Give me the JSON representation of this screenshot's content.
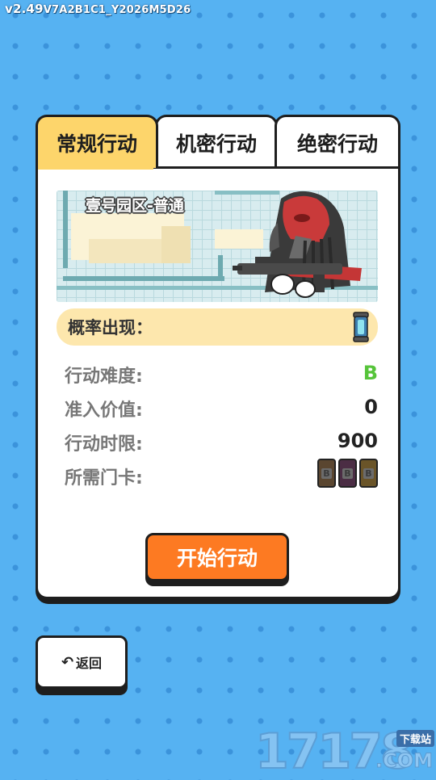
{
  "version": {
    "major": "v2.49",
    "build": "V7A2B1C1_Y2026M5D26"
  },
  "tabs": [
    {
      "label": "常规行动",
      "active": true
    },
    {
      "label": "机密行动",
      "active": false
    },
    {
      "label": "绝密行动",
      "active": false
    }
  ],
  "map": {
    "title": "壹号园区-普通"
  },
  "probability": {
    "label": "概率出现：",
    "item_icon": "capsule-item-icon"
  },
  "stats": [
    {
      "label": "行动难度:",
      "value": "B"
    },
    {
      "label": "准入价值:",
      "value": "0"
    },
    {
      "label": "行动时限:",
      "value": "900"
    },
    {
      "label": "所需门卡:",
      "cards": [
        "B",
        "B",
        "B"
      ]
    }
  ],
  "card_colors": [
    "#5a4630",
    "#4b2d44",
    "#6a5428"
  ],
  "start_button": {
    "label": "开始行动"
  },
  "back_button": {
    "label": "返回",
    "icon": "undo-arrow-icon"
  },
  "watermark": {
    "number": "17178",
    "tag": "下载站",
    "suffix": ".COM"
  },
  "colors": {
    "background": "#56b2f2",
    "tab_active": "#fdd56b",
    "start": "#fd7a22",
    "grade": "#56c43a"
  }
}
